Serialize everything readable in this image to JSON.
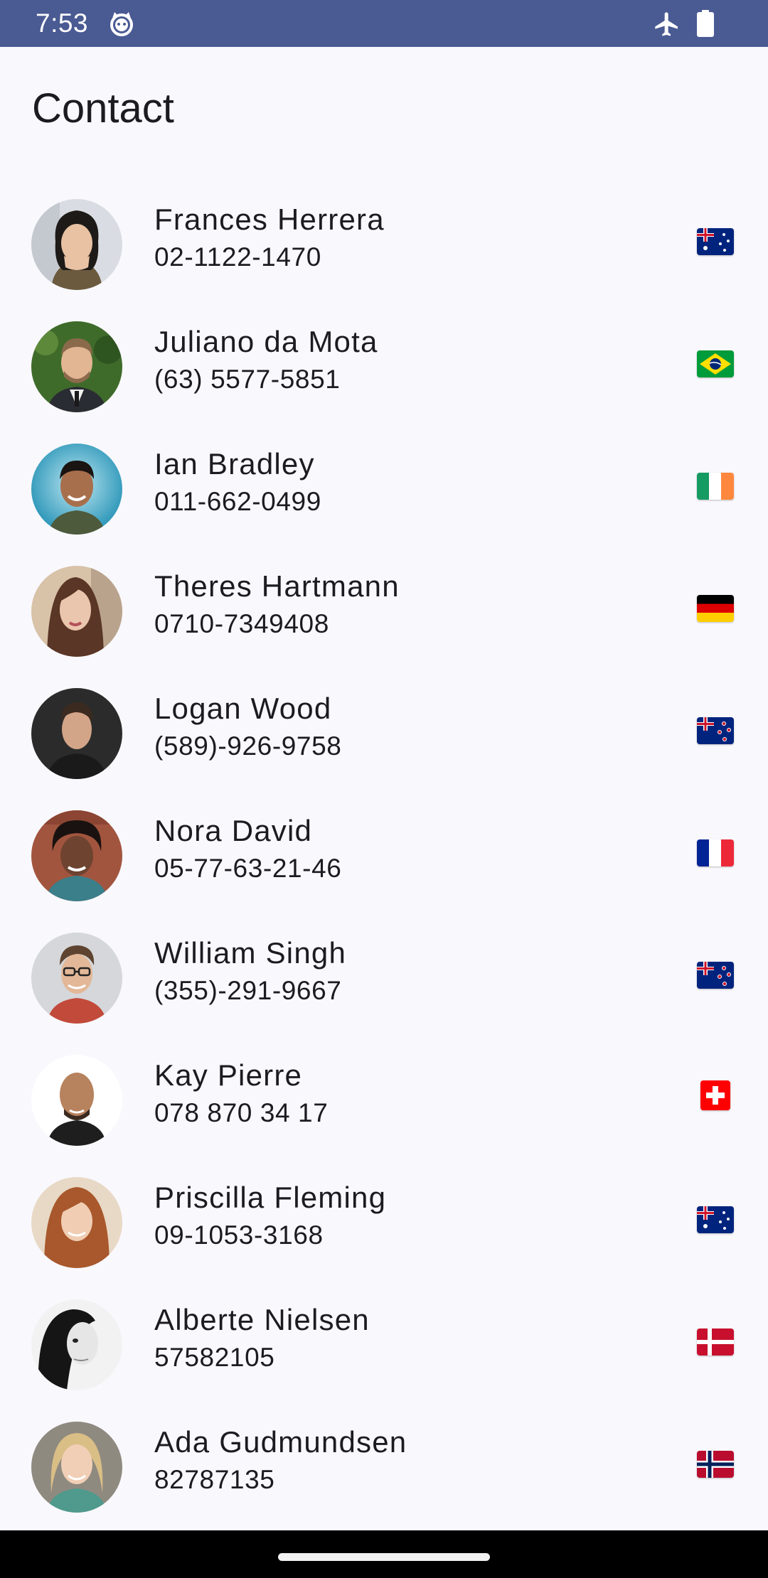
{
  "status_bar": {
    "time": "7:53",
    "icons": [
      "cat-icon",
      "airplane-icon",
      "battery-icon"
    ],
    "background": "#4A5A93"
  },
  "title": "Contact",
  "contacts": [
    {
      "name": "Frances Herrera",
      "phone": "02-1122-1470",
      "flag": "AU",
      "flag_icon": "australia-flag-icon"
    },
    {
      "name": "Juliano da Mota",
      "phone": "(63) 5577-5851",
      "flag": "BR",
      "flag_icon": "brazil-flag-icon"
    },
    {
      "name": "Ian Bradley",
      "phone": "011-662-0499",
      "flag": "IE",
      "flag_icon": "ireland-flag-icon"
    },
    {
      "name": "Theres Hartmann",
      "phone": "0710-7349408",
      "flag": "DE",
      "flag_icon": "germany-flag-icon"
    },
    {
      "name": "Logan Wood",
      "phone": "(589)-926-9758",
      "flag": "NZ",
      "flag_icon": "new-zealand-flag-icon"
    },
    {
      "name": "Nora David",
      "phone": "05-77-63-21-46",
      "flag": "FR",
      "flag_icon": "france-flag-icon"
    },
    {
      "name": "William Singh",
      "phone": "(355)-291-9667",
      "flag": "NZ",
      "flag_icon": "new-zealand-flag-icon"
    },
    {
      "name": "Kay Pierre",
      "phone": "078 870 34 17",
      "flag": "CH",
      "flag_icon": "switzerland-flag-icon"
    },
    {
      "name": "Priscilla Fleming",
      "phone": "09-1053-3168",
      "flag": "AU",
      "flag_icon": "australia-flag-icon"
    },
    {
      "name": "Alberte Nielsen",
      "phone": "57582105",
      "flag": "DK",
      "flag_icon": "denmark-flag-icon"
    },
    {
      "name": "Ada Gudmundsen",
      "phone": "82787135",
      "flag": "NO",
      "flag_icon": "norway-flag-icon"
    }
  ],
  "colors": {
    "background": "#F9F8FD",
    "text": "#1C1B1F",
    "nav_bar": "#000000"
  }
}
